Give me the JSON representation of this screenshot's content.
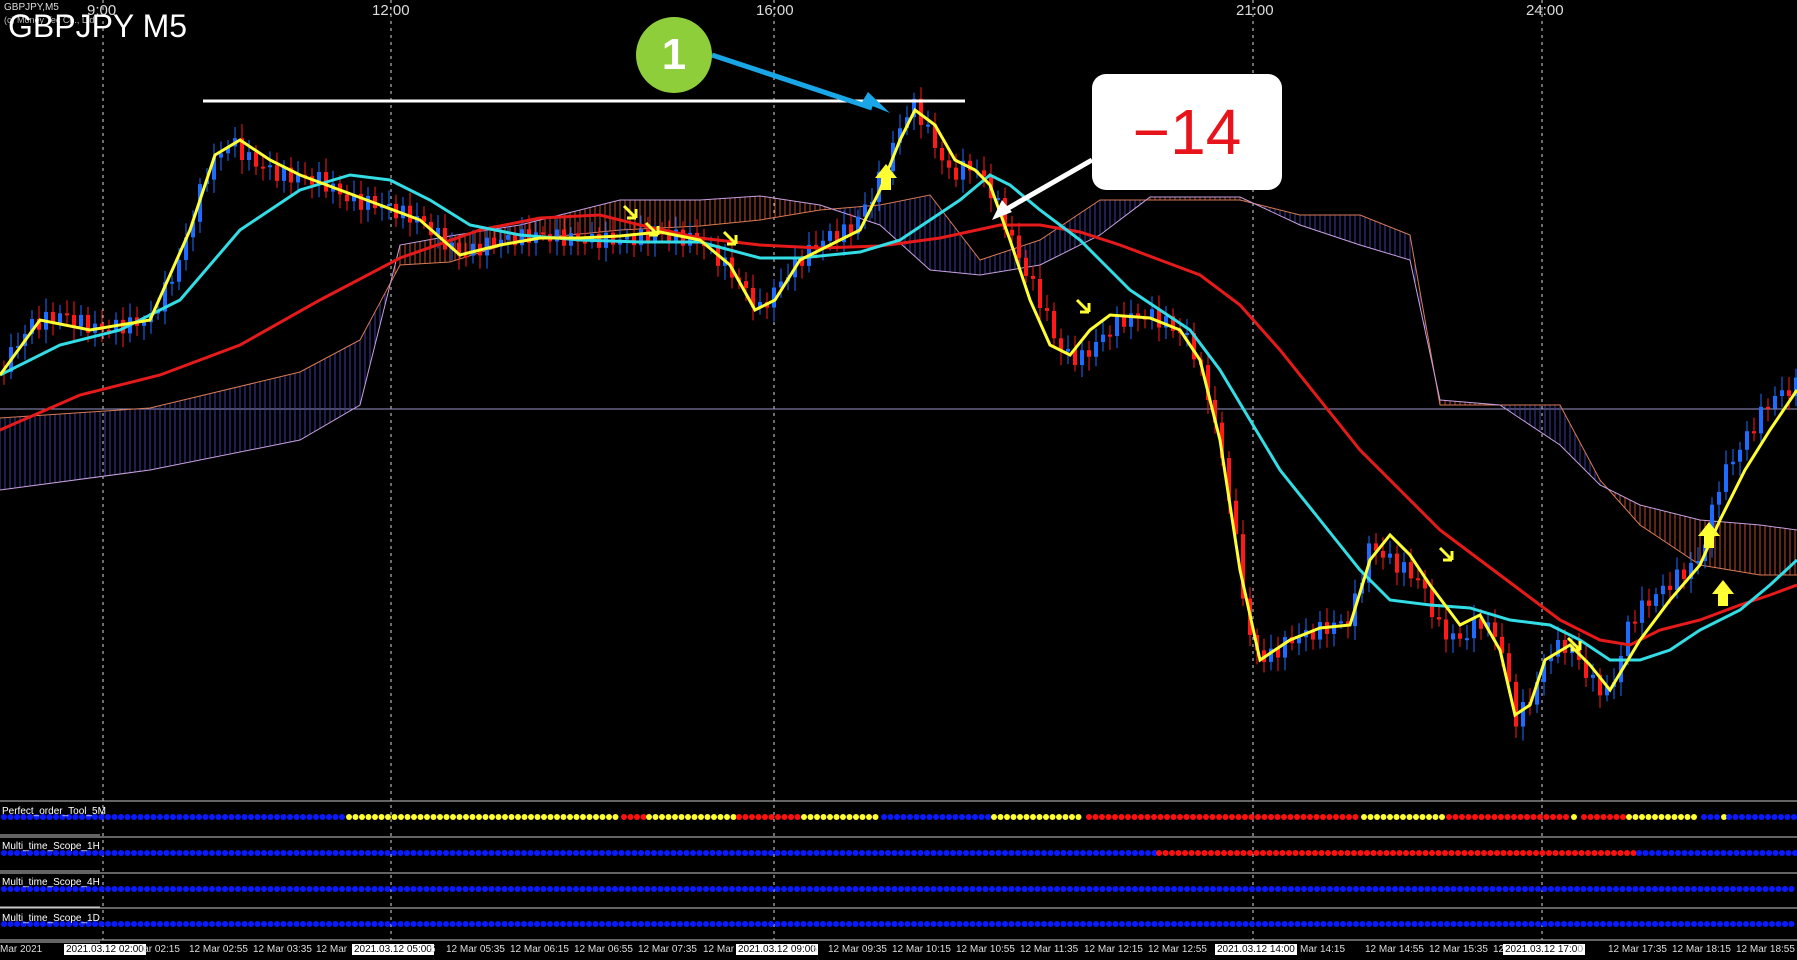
{
  "chart_header": {
    "symbol_small": "GBPJPY,M5",
    "symbol_title": "GBPJPY M5",
    "copyright": "(c) Money Tec Co., Ltd."
  },
  "hour_labels": [
    "9:00",
    "12:00",
    "16:00",
    "21:00",
    "24:00"
  ],
  "callouts": {
    "entry_number": "1",
    "result": "−14"
  },
  "indicators": [
    {
      "name": "Perfect_order_Tool_5M"
    },
    {
      "name": "Multi_time_Scope_1H"
    },
    {
      "name": "Multi_time_Scope_4H"
    },
    {
      "name": "Multi_time_Scope_1D"
    }
  ],
  "time_axis": [
    {
      "text": "Mar 2021",
      "boxed": false
    },
    {
      "text": "2021.03.12 02:00",
      "boxed": true
    },
    {
      "text": "lar 02:15",
      "boxed": false
    },
    {
      "text": "12 Mar 02:55",
      "boxed": false
    },
    {
      "text": "12 Mar 03:35",
      "boxed": false
    },
    {
      "text": "12 Mar",
      "boxed": false
    },
    {
      "text": "2021.03.12 05:00",
      "boxed": true
    },
    {
      "text": "5",
      "boxed": false
    },
    {
      "text": "12 Mar 05:35",
      "boxed": false
    },
    {
      "text": "12 Mar 06:15",
      "boxed": false
    },
    {
      "text": "12 Mar 06:55",
      "boxed": false
    },
    {
      "text": "12 Mar 07:35",
      "boxed": false
    },
    {
      "text": "12 Mar",
      "boxed": false
    },
    {
      "text": "2021.03.12 09:00",
      "boxed": true
    },
    {
      "text": "5",
      "boxed": false
    },
    {
      "text": "12 Mar 09:35",
      "boxed": false
    },
    {
      "text": "12 Mar 10:15",
      "boxed": false
    },
    {
      "text": "12 Mar 10:55",
      "boxed": false
    },
    {
      "text": "12 Mar 11:35",
      "boxed": false
    },
    {
      "text": "12 Mar 12:15",
      "boxed": false
    },
    {
      "text": "12 Mar 12:55",
      "boxed": false
    },
    {
      "text": "2021.03.12 14:00",
      "boxed": true
    },
    {
      "text": "Mar 14:15",
      "boxed": false
    },
    {
      "text": "12 Mar 14:55",
      "boxed": false
    },
    {
      "text": "12 Mar 15:35",
      "boxed": false
    },
    {
      "text": "12 Mar",
      "boxed": false
    },
    {
      "text": "2021.03.12 17:00",
      "boxed": true
    },
    {
      "text": "0",
      "boxed": false
    },
    {
      "text": "12 Mar 17:35",
      "boxed": false
    },
    {
      "text": "12 Mar 18:15",
      "boxed": false
    },
    {
      "text": "12 Mar 18:55",
      "boxed": false
    }
  ],
  "colors": {
    "background": "#000000",
    "bull_candle": "#1e6bff",
    "bear_candle": "#ff1a1a",
    "ma_fast": "#ffff33",
    "ma_mid": "#33dde6",
    "ma_slow": "#e61a1a",
    "kumo_bull": "#3a3aa0",
    "kumo_bear": "#b84a2a",
    "dot_blue": "#0a1aff",
    "dot_yellow": "#ffff33",
    "dot_red": "#ff1010",
    "callout_green": "#8fce3b",
    "arrow_blue": "#1aa6e6",
    "result_red": "#e8141c"
  }
}
